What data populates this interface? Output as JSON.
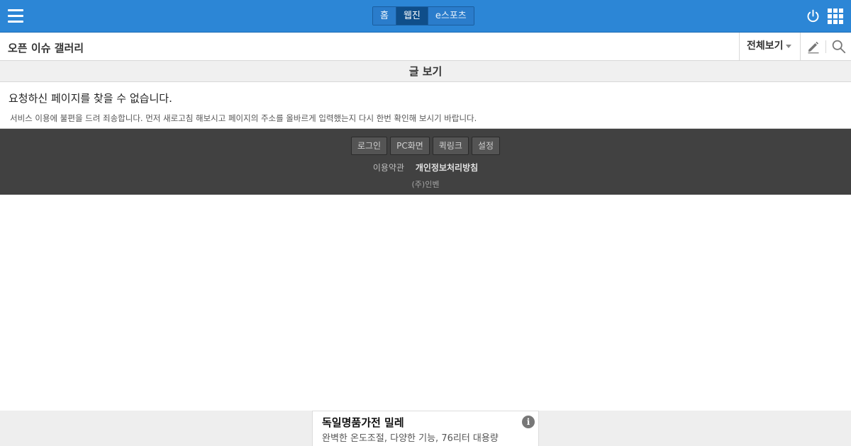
{
  "header": {
    "tabs": [
      {
        "label": "홈",
        "active": false
      },
      {
        "label": "웹진",
        "active": true
      },
      {
        "label": "e스포츠",
        "active": false
      }
    ],
    "icons": {
      "menu": "hamburger-icon",
      "power": "power-icon",
      "apps": "grid-icon"
    },
    "accent_color": "#2c86d6"
  },
  "subbar": {
    "gallery_title": "오픈 이슈 갤러리",
    "view_all": "전체보기",
    "icons": {
      "write": "pencil-icon",
      "search": "search-icon"
    }
  },
  "section": {
    "heading": "글 보기"
  },
  "content": {
    "error_title": "요청하신 페이지를 찾을 수 없습니다.",
    "error_desc": "서비스 이용에 불편을 드려 죄송합니다. 먼저 새로고침 해보시고 페이지의 주소를 올바르게 입력했는지 다시 한번 확인해 보시기 바랍니다."
  },
  "footer": {
    "buttons": [
      "로그인",
      "PC화면",
      "퀵링크",
      "설정"
    ],
    "links": [
      {
        "label": "이용약관",
        "bold": false
      },
      {
        "label": "개인정보처리방침",
        "bold": true
      }
    ],
    "company": "(주)인벤"
  },
  "ad": {
    "title": "독일명품가전 밀레",
    "desc": "완벽한 온도조절, 다양한 기능, 76리터 대용량",
    "info_icon": "info-icon"
  }
}
